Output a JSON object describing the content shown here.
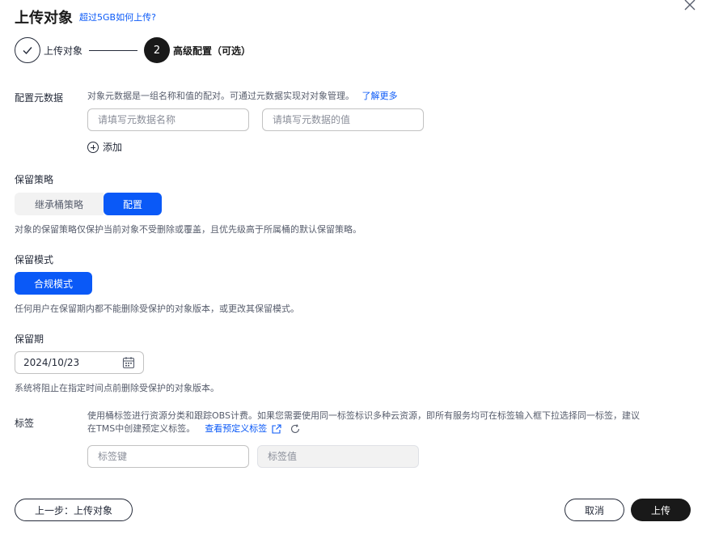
{
  "header": {
    "title": "上传对象",
    "help_link": "超过5GB如何上传?"
  },
  "steps": [
    {
      "label": "上传对象",
      "state": "done"
    },
    {
      "number": "2",
      "label": "高级配置（可选）",
      "state": "active"
    }
  ],
  "metadata": {
    "label": "配置元数据",
    "description": "对象元数据是一组名称和值的配对。可通过元数据实现对对象管理。",
    "learn_more": "了解更多",
    "name_placeholder": "请填写元数据名称",
    "value_placeholder": "请填写元数据的值",
    "add_label": "添加"
  },
  "retention_policy": {
    "label": "保留策略",
    "options": [
      "继承桶策略",
      "配置"
    ],
    "selected": "配置",
    "description": "对象的保留策略仅保护当前对象不受删除或覆盖，且优先级高于所属桶的默认保留策略。"
  },
  "retention_mode": {
    "label": "保留模式",
    "button": "合规模式",
    "description": "任何用户在保留期内都不能删除受保护的对象版本，或更改其保留模式。"
  },
  "retention_period": {
    "label": "保留期",
    "date": "2024/10/23",
    "description": "系统将阻止在指定时间点前删除受保护的对象版本。"
  },
  "tags": {
    "label": "标签",
    "description_line1": "使用桶标签进行资源分类和跟踪OBS计费。如果您需要使用同一标签标识多种云资源，即所有服务均可在标签输入框下拉选择同一标签，建议",
    "description_line2": "在TMS中创建预定义标签。",
    "view_predefined": "查看预定义标签",
    "key_placeholder": "标签键",
    "value_placeholder": "标签值"
  },
  "footer": {
    "prev_label": "上一步：上传对象",
    "cancel_label": "取消",
    "upload_label": "上传"
  },
  "colors": {
    "primary": "#0a59f7",
    "dark": "#191919"
  }
}
